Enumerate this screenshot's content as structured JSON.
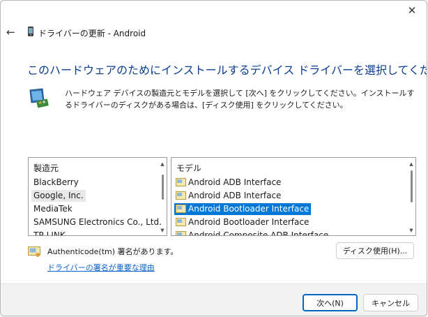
{
  "window": {
    "title": "ドライバーの更新 - Android",
    "close_glyph": "✕",
    "back_glyph": "←"
  },
  "heading": "このハードウェアのためにインストールするデバイス ドライバーを選択してください。",
  "instructions": "ハードウェア デバイスの製造元とモデルを選択して [次へ] をクリックしてください。インストールするドライバーのディスクがある場合は、[ディスク使用] をクリックしてください。",
  "manufacturer_list": {
    "header": "製造元",
    "items": [
      "BlackBerry",
      "Google, Inc.",
      "MediaTek",
      "SAMSUNG Electronics Co., Ltd.",
      "TP-LINK"
    ],
    "hover_index": 1
  },
  "model_list": {
    "header": "モデル",
    "items": [
      "Android ADB Interface",
      "Android ADB Interface",
      "Android Bootloader Interface",
      "Android Bootloader Interface",
      "Android Composite ADB Interface"
    ],
    "selected_index": 2
  },
  "signature": {
    "text": "Authenticode(tm) 署名があります。",
    "link": "ドライバーの署名が重要な理由"
  },
  "buttons": {
    "have_disk": "ディスク使用(H)...",
    "next": "次へ(N)",
    "cancel": "キャンセル"
  },
  "colors": {
    "accent": "#0078d7",
    "heading": "#0b3d91",
    "link": "#0a62c9"
  }
}
